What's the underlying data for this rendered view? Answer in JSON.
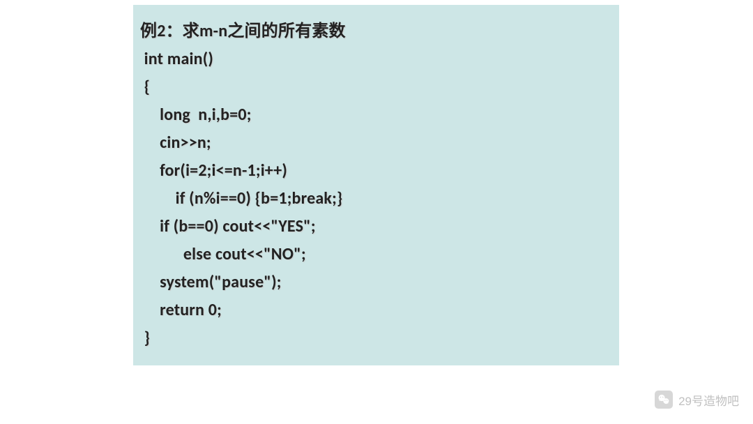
{
  "code": {
    "title": "例2：求m-n之间的所有素数",
    "lines": [
      " int main()",
      " {",
      "     long  n,i,b=0;",
      "     cin>>n;",
      "     for(i=2;i<=n-1;i++)",
      "         if (n%i==0) {b=1;break;}",
      "     if (b==0) cout<<\"YES\";",
      "           else cout<<\"NO\";",
      "     system(\"pause\");",
      "     return 0;",
      " }"
    ]
  },
  "watermark": {
    "text": "29号造物吧"
  }
}
